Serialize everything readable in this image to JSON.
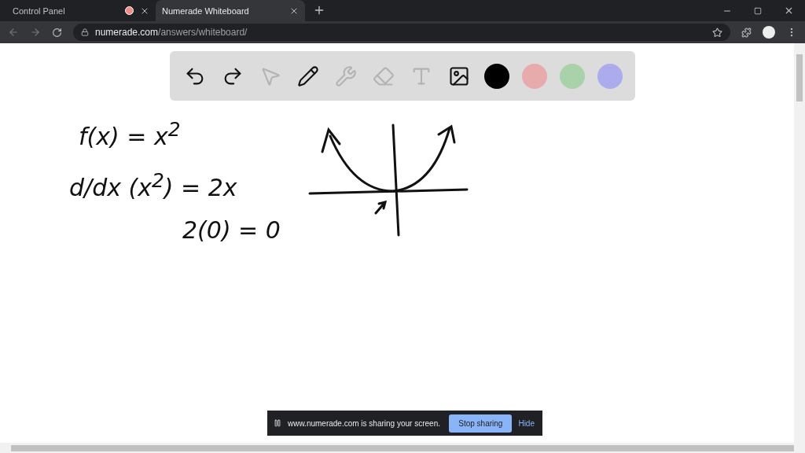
{
  "tabs": [
    {
      "title": "Control Panel",
      "selected": false,
      "recording": true
    },
    {
      "title": "Numerade Whiteboard",
      "selected": true,
      "recording": false
    }
  ],
  "address": {
    "domain": "numerade.com",
    "path": "/answers/whiteboard/"
  },
  "toolbar": {
    "tools": [
      {
        "kind": "undo",
        "disabled": false
      },
      {
        "kind": "redo",
        "disabled": false
      },
      {
        "kind": "pointer",
        "disabled": true
      },
      {
        "kind": "pen",
        "disabled": false
      },
      {
        "kind": "tools",
        "disabled": true
      },
      {
        "kind": "eraser",
        "disabled": true
      },
      {
        "kind": "text",
        "disabled": true
      },
      {
        "kind": "image",
        "disabled": false
      }
    ],
    "colors": [
      {
        "color": "#000000"
      },
      {
        "color": "#e8abab"
      },
      {
        "color": "#aad2aa"
      },
      {
        "color": "#ababee"
      }
    ]
  },
  "board": {
    "notes": [
      {
        "text": "f(x) = x$^{2}$"
      },
      {
        "text": "d/dx (x$^{2}$) = 2x"
      },
      {
        "text": "2(0) = 0"
      }
    ]
  },
  "share_bar": {
    "message": "www.numerade.com is sharing your screen.",
    "stop_button": "Stop sharing",
    "hide_link": "Hide"
  }
}
